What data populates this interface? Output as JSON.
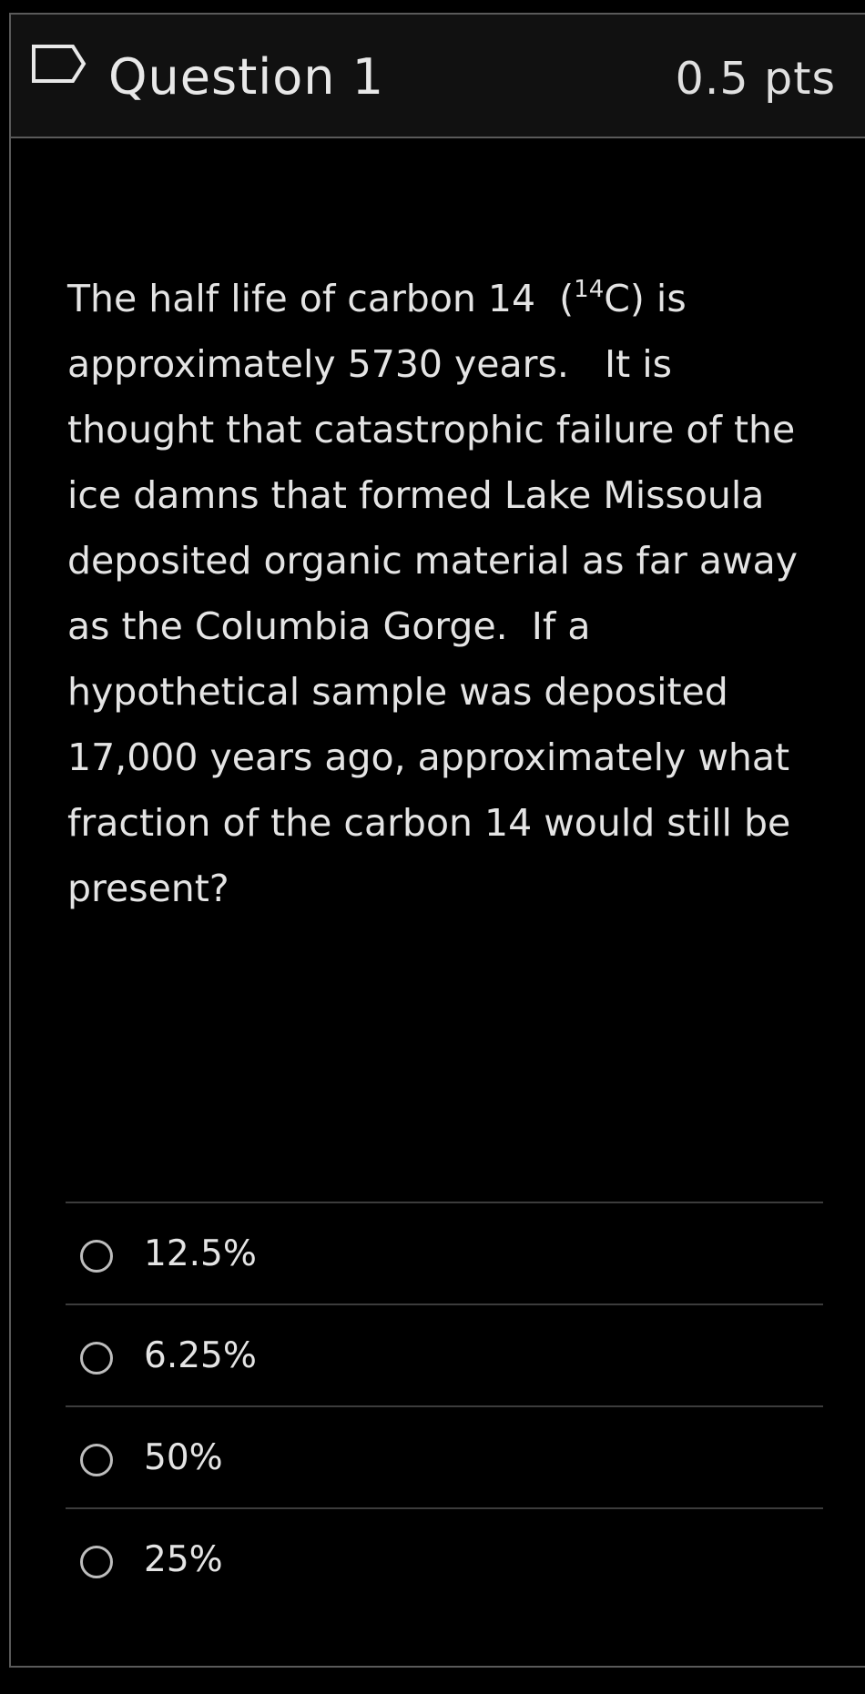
{
  "header": {
    "title": "Question 1",
    "points": "0.5 pts",
    "flag_icon": "flag-icon"
  },
  "question": {
    "line1_before": "The half life of carbon 14  (",
    "line1_sup": "14",
    "line1_after": "C) is",
    "lines": [
      "approximately 5730 years.   It is",
      "thought that catastrophic failure of the",
      "ice damns that formed Lake Missoula",
      "deposited organic material as far away",
      "as the Columbia Gorge.  If a",
      "hypothetical sample was deposited",
      "17,000 years ago, approximately what",
      "fraction of the carbon 14 would still be",
      "present?"
    ]
  },
  "answers": [
    {
      "label": "12.5%",
      "selected": false
    },
    {
      "label": "6.25%",
      "selected": false
    },
    {
      "label": "50%",
      "selected": false
    },
    {
      "label": "25%",
      "selected": false
    }
  ],
  "colors": {
    "background": "#000000",
    "header_bg": "#111111",
    "border": "#5a5a5a",
    "text": "#e4e4e4"
  }
}
